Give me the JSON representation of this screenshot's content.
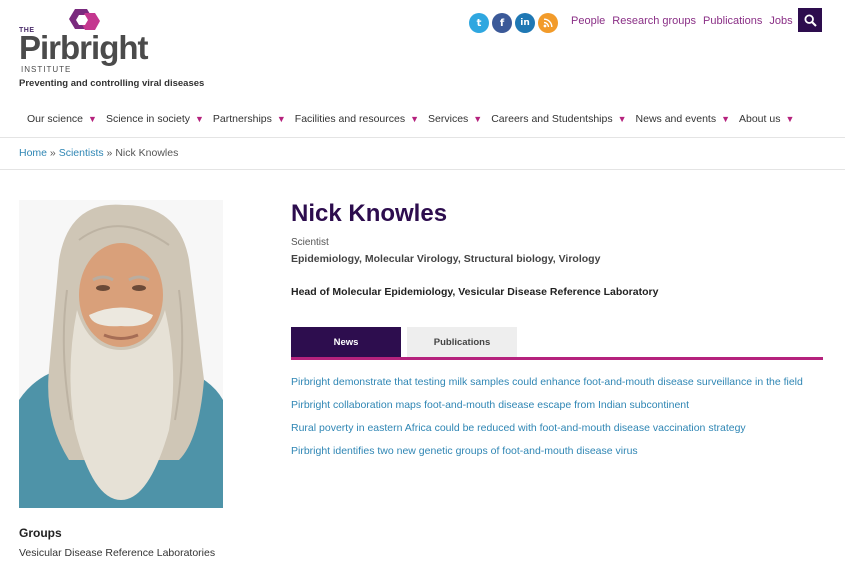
{
  "brand": {
    "logo_the": "THE",
    "logo_word": "Pirbright",
    "logo_institute": "INSTITUTE",
    "tagline": "Preventing and controlling viral diseases",
    "purple": "#2d0d4e",
    "magenta": "#b5227d",
    "link_blue": "#2f86b4"
  },
  "social": [
    {
      "name": "twitter-icon",
      "glyph": "t"
    },
    {
      "name": "facebook-icon",
      "glyph": "f"
    },
    {
      "name": "linkedin-icon",
      "glyph": "in"
    },
    {
      "name": "rss-icon",
      "glyph": ")"
    }
  ],
  "toplinks": [
    "People",
    "Research groups",
    "Publications",
    "Jobs"
  ],
  "nav": [
    "Our science",
    "Science in society",
    "Partnerships",
    "Facilities and resources",
    "Services",
    "Careers and Studentships",
    "News and events",
    "About us"
  ],
  "breadcrumb": {
    "home": "Home",
    "sep1": " » ",
    "scientists": "Scientists",
    "sep2": " » ",
    "current": "Nick Knowles"
  },
  "profile": {
    "name": "Nick Knowles",
    "role": "Scientist",
    "topics": "Epidemiology, Molecular Virology, Structural biology, Virology",
    "position": "Head of Molecular Epidemiology, Vesicular Disease Reference Laboratory"
  },
  "tabs": {
    "news": "News",
    "publications": "Publications",
    "active": "News"
  },
  "news": [
    "Pirbright demonstrate that testing milk samples could enhance foot-and-mouth disease surveillance in the field",
    "Pirbright collaboration maps foot-and-mouth disease escape from Indian subcontinent",
    "Rural poverty in eastern Africa could be reduced with foot-and-mouth disease vaccination strategy",
    "Pirbright identifies two new genetic groups of foot-and-mouth disease virus"
  ],
  "groups": {
    "title": "Groups",
    "items": [
      "Vesicular Disease Reference Laboratories"
    ]
  }
}
